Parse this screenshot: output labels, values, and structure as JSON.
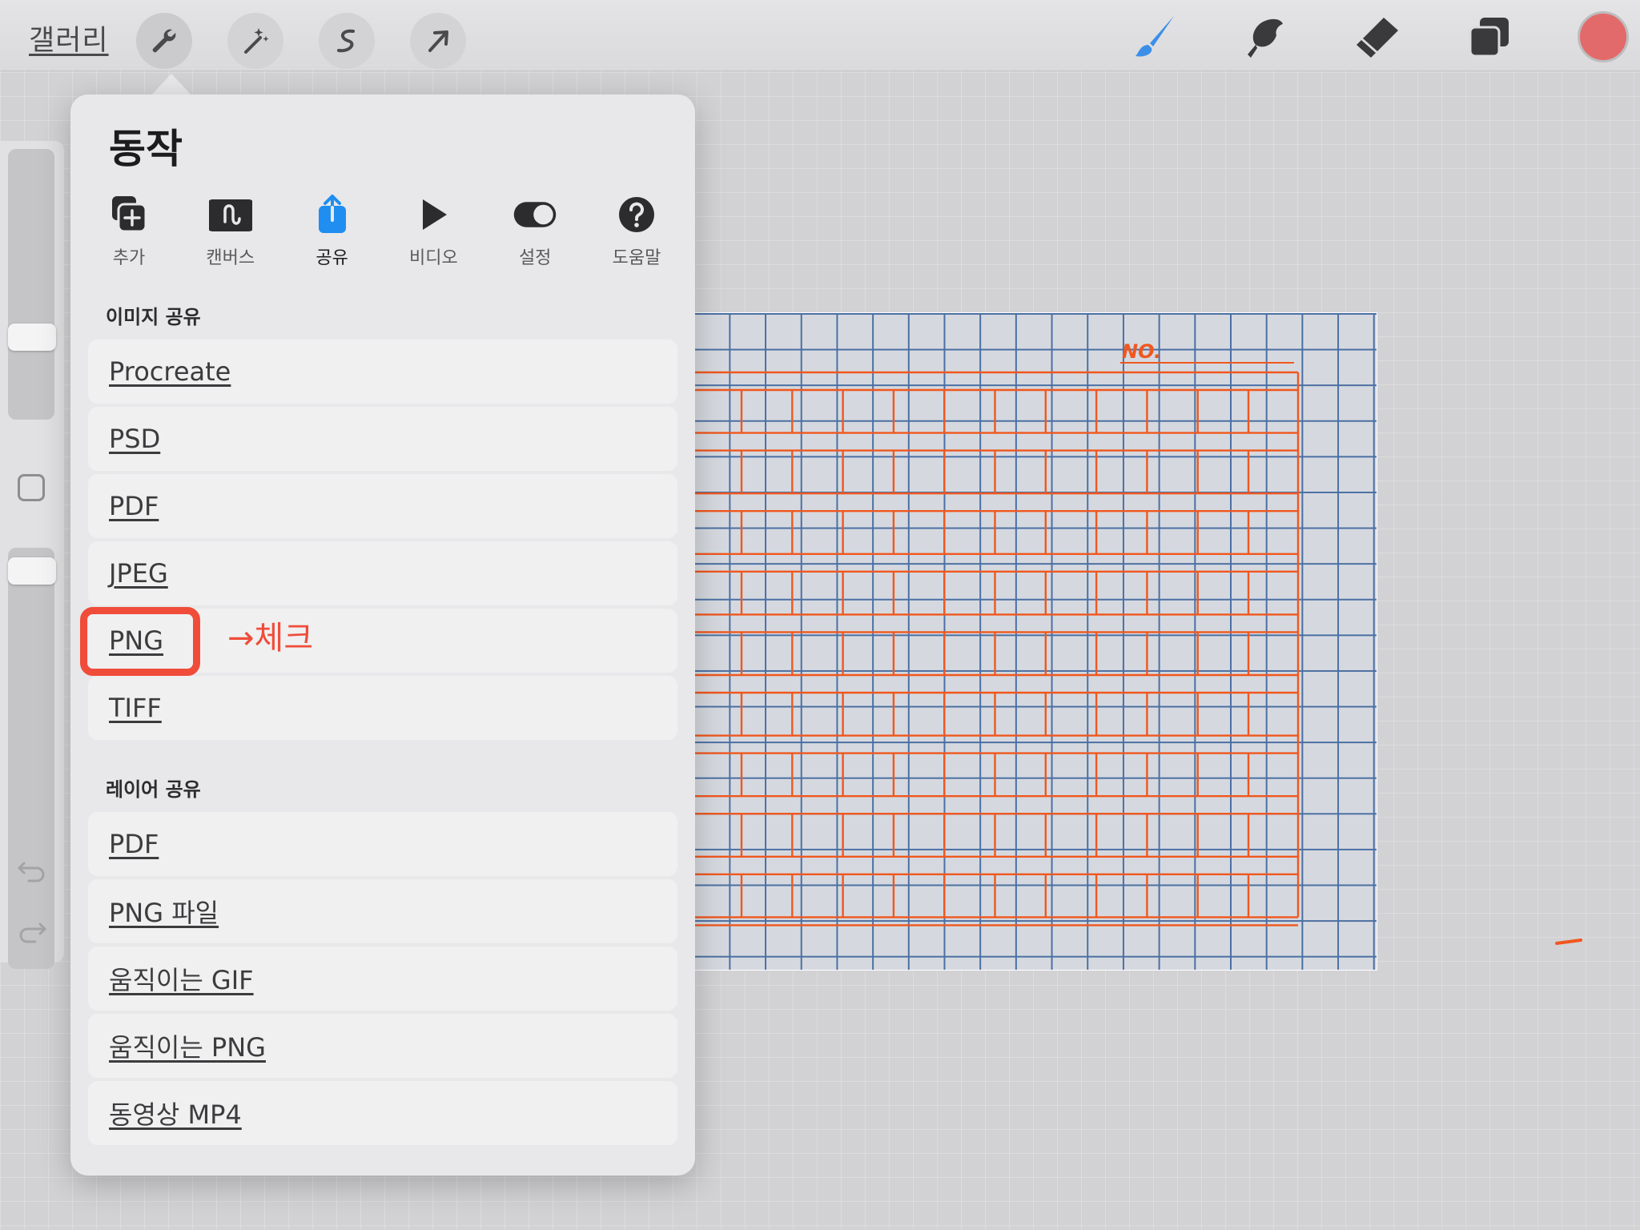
{
  "toolbar": {
    "gallery_label": "갤러리",
    "left_tools": [
      "wrench-icon",
      "magic-wand-icon",
      "selection-icon",
      "transform-arrow-icon"
    ],
    "right_tools": [
      "brush-icon",
      "smudge-icon",
      "eraser-icon",
      "layers-icon"
    ],
    "brush_color": "#3b8fe8",
    "current_color": "#e36a6a"
  },
  "actions": {
    "title": "동작",
    "tabs": [
      {
        "label": "추가",
        "icon": "add-icon",
        "active": false
      },
      {
        "label": "캔버스",
        "icon": "canvas-icon",
        "active": false
      },
      {
        "label": "공유",
        "icon": "share-icon",
        "active": true
      },
      {
        "label": "비디오",
        "icon": "play-icon",
        "active": false
      },
      {
        "label": "설정",
        "icon": "toggle-icon",
        "active": false
      },
      {
        "label": "도움말",
        "icon": "help-icon",
        "active": false
      }
    ],
    "image_share": {
      "heading": "이미지 공유",
      "items": [
        "Procreate",
        "PSD",
        "PDF",
        "JPEG",
        "PNG",
        "TIFF"
      ]
    },
    "layer_share": {
      "heading": "레이어 공유",
      "items": [
        "PDF",
        "PNG 파일",
        "움직이는 GIF",
        "움직이는 PNG",
        "동영상 MP4"
      ]
    }
  },
  "canvas": {
    "label": "NO.",
    "grid_color": "#4b6fa3",
    "ink_color": "#f0571f"
  },
  "annotation": {
    "color": "#f04c3a",
    "note": "→체크"
  }
}
